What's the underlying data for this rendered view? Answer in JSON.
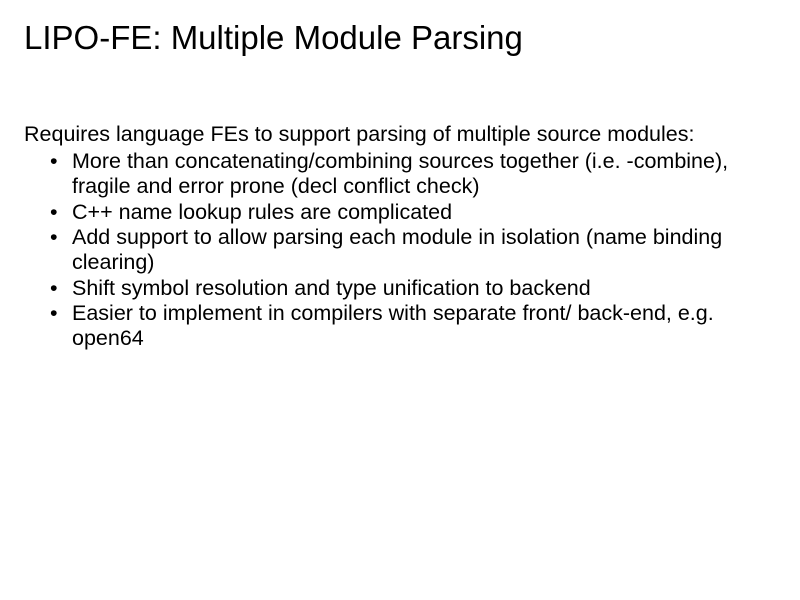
{
  "title": "LIPO-FE: Multiple Module Parsing",
  "intro": "Requires language FEs to support parsing of multiple source modules:",
  "bullets": [
    "More than concatenating/combining sources together (i.e. -combine), fragile and error prone (decl conflict check)",
    "C++ name lookup rules are complicated",
    "Add support to allow parsing each module in isolation (name binding clearing)",
    "Shift symbol resolution and type unification to backend",
    "Easier to implement in compilers with separate front/ back-end, e.g. open64"
  ]
}
